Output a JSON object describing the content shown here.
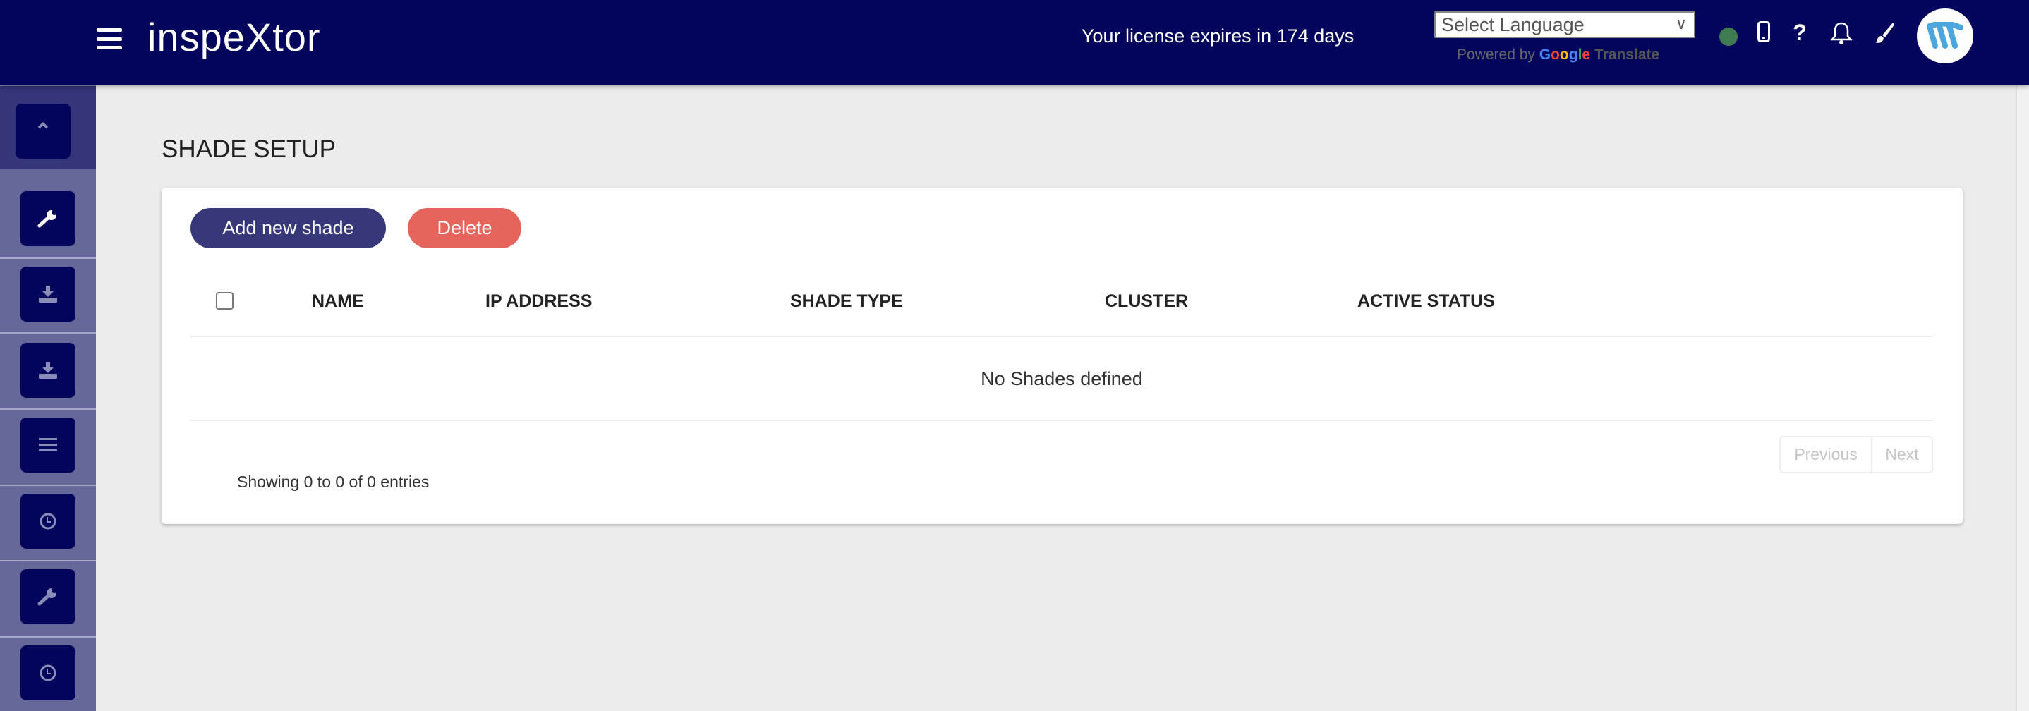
{
  "header": {
    "app_title": "inspeXtor",
    "license_text": "Your license expires in 174 days",
    "language_select": "Select Language",
    "powered_by": "Powered by",
    "google": "Google",
    "translate": "Translate",
    "status_color": "#3f7c52",
    "icons": [
      "menu-icon",
      "status-dot",
      "mobile-icon",
      "help-icon",
      "bell-icon",
      "brush-icon",
      "avatar"
    ]
  },
  "sidebar": {
    "items": [
      "chevron-up-icon",
      "wrench-icon",
      "download-icon",
      "download-icon",
      "list-icon",
      "clock-icon",
      "wrench-icon",
      "clock-icon"
    ]
  },
  "page": {
    "title": "SHADE SETUP",
    "add_button": "Add new shade",
    "delete_button": "Delete",
    "columns": [
      "NAME",
      "IP ADDRESS",
      "SHADE TYPE",
      "CLUSTER",
      "ACTIVE STATUS"
    ],
    "empty_message": "No Shades defined",
    "showing": "Showing 0 to 0 of 0 entries",
    "previous": "Previous",
    "next": "Next",
    "accent": "#37387a",
    "danger": "#e5645c"
  }
}
